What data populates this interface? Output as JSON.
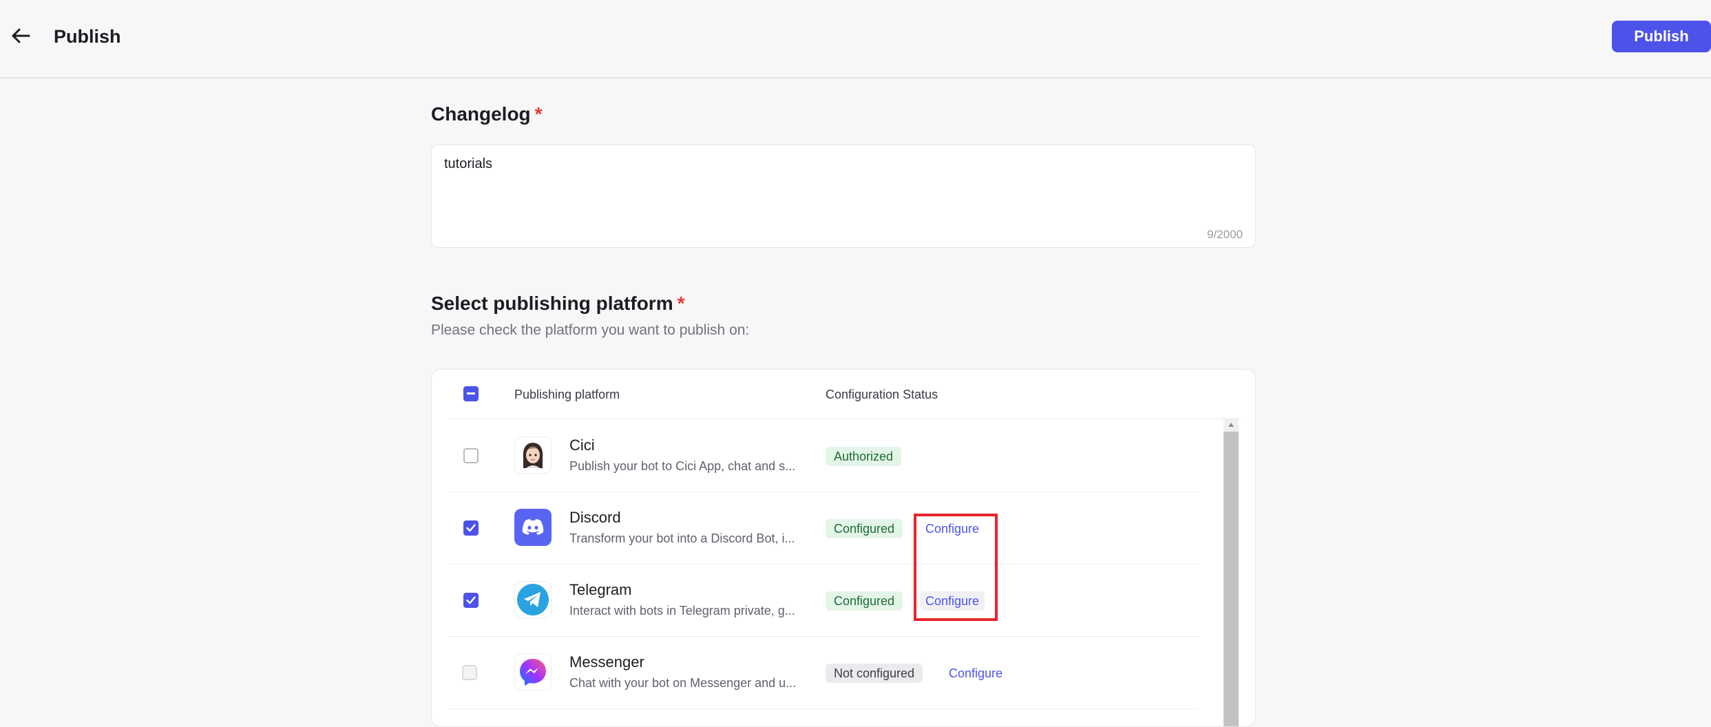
{
  "header": {
    "title": "Publish",
    "publish_label": "Publish"
  },
  "changelog": {
    "title": "Changelog",
    "required_mark": "*",
    "value": "tutorials",
    "char_count": "9/2000"
  },
  "platforms": {
    "title": "Select publishing platform",
    "required_mark": "*",
    "subtitle": "Please check the platform you want to publish on:",
    "columns": [
      "Publishing platform",
      "Configuration Status"
    ],
    "rows": [
      {
        "name": "Cici",
        "description": "Publish your bot to Cici App, chat and s...",
        "status": "Authorized",
        "checked": false,
        "configure": ""
      },
      {
        "name": "Discord",
        "description": "Transform your bot into a Discord Bot, i...",
        "status": "Configured",
        "checked": true,
        "configure": "Configure"
      },
      {
        "name": "Telegram",
        "description": "Interact with bots in Telegram private, g...",
        "status": "Configured",
        "checked": true,
        "configure": "Configure"
      },
      {
        "name": "Messenger",
        "description": "Chat with your bot on Messenger and u...",
        "status": "Not configured",
        "checked": false,
        "configure": "Configure"
      }
    ]
  },
  "colors": {
    "accent": "#4d53e8",
    "highlight_box": "#e8242b",
    "discord": "#5865f2",
    "telegram": "#2aa3e0"
  }
}
